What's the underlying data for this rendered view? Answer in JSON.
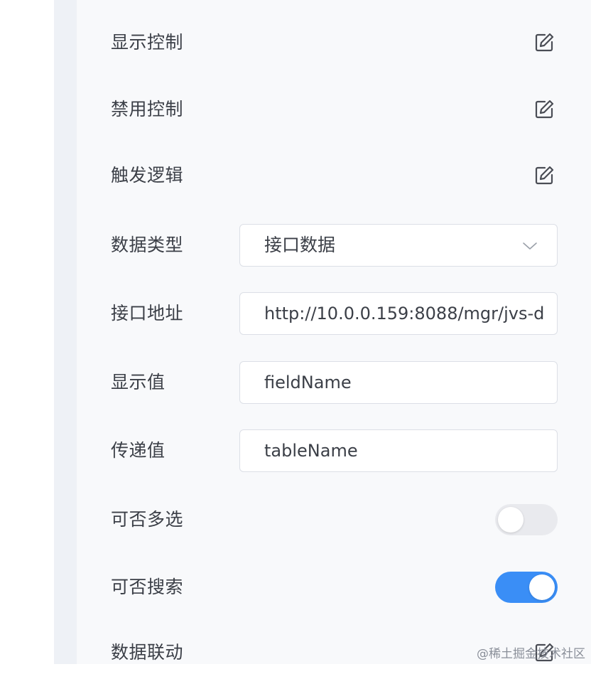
{
  "form": {
    "rows": [
      {
        "label": "显示控制",
        "type": "edit",
        "icon": "edit-icon"
      },
      {
        "label": "禁用控制",
        "type": "edit",
        "icon": "edit-icon"
      },
      {
        "label": "触发逻辑",
        "type": "edit",
        "icon": "edit-icon"
      },
      {
        "label": "数据类型",
        "type": "select",
        "value": "接口数据",
        "icon": "chevron-down-icon"
      },
      {
        "label": "接口地址",
        "type": "input",
        "value": "http://10.0.0.159:8088/mgr/jvs-d"
      },
      {
        "label": "显示值",
        "type": "input",
        "value": "fieldName"
      },
      {
        "label": "传递值",
        "type": "input",
        "value": "tableName"
      },
      {
        "label": "可否多选",
        "type": "toggle",
        "on": false
      },
      {
        "label": "可否搜索",
        "type": "toggle",
        "on": true
      },
      {
        "label": "数据联动",
        "type": "edit",
        "icon": "edit-icon"
      }
    ]
  },
  "colors": {
    "toggle_on": "#3a8ef6",
    "toggle_off": "#e9eaee",
    "panel_bg": "#f8f9fb",
    "rail_bg": "#eef1f6"
  },
  "watermark": "@稀土掘金技术社区"
}
